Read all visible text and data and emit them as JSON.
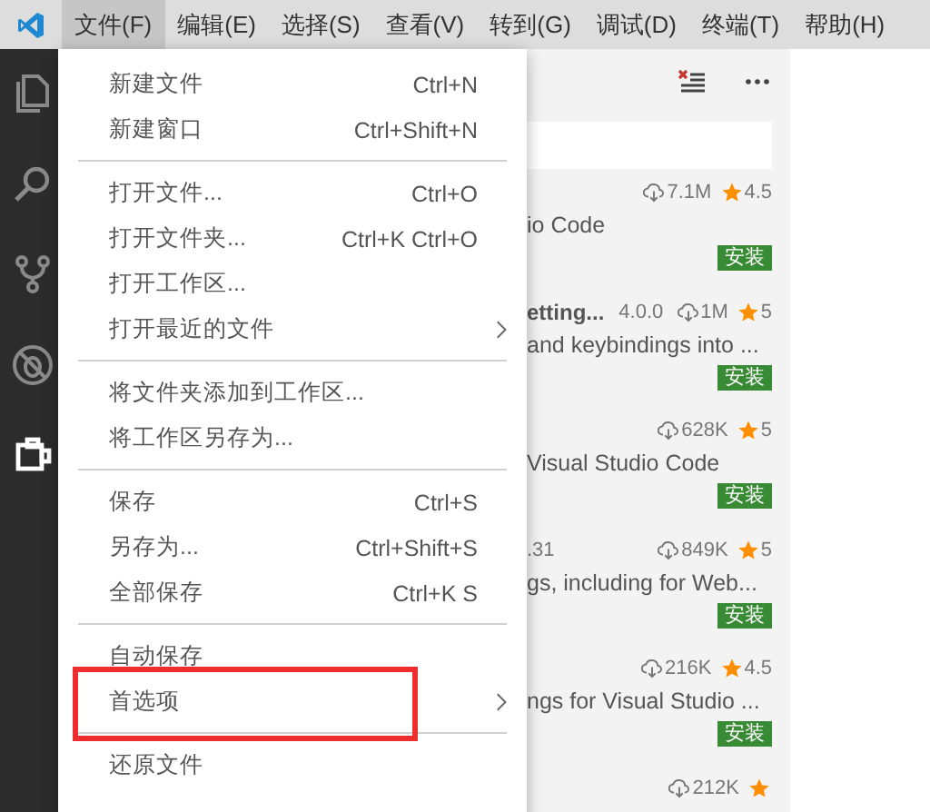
{
  "menubar": {
    "menus": [
      {
        "label": "文件(F)",
        "selected": true
      },
      {
        "label": "编辑(E)",
        "selected": false
      },
      {
        "label": "选择(S)",
        "selected": false
      },
      {
        "label": "查看(V)",
        "selected": false
      },
      {
        "label": "转到(G)",
        "selected": false
      },
      {
        "label": "调试(D)",
        "selected": false
      },
      {
        "label": "终端(T)",
        "selected": false
      },
      {
        "label": "帮助(H)",
        "selected": false
      }
    ]
  },
  "activity_bar": [
    {
      "kind": "files",
      "selected": false
    },
    {
      "kind": "search",
      "selected": false
    },
    {
      "kind": "source-control",
      "selected": false
    },
    {
      "kind": "debug",
      "selected": false
    },
    {
      "kind": "extensions",
      "selected": true
    }
  ],
  "file_menu": {
    "items": [
      {
        "kind": "item",
        "label": "新建文件",
        "shortcut": "Ctrl+N"
      },
      {
        "kind": "item",
        "label": "新建窗口",
        "shortcut": "Ctrl+Shift+N"
      },
      {
        "kind": "separator"
      },
      {
        "kind": "item",
        "label": "打开文件...",
        "shortcut": "Ctrl+O"
      },
      {
        "kind": "item",
        "label": "打开文件夹...",
        "shortcut": "Ctrl+K Ctrl+O"
      },
      {
        "kind": "item",
        "label": "打开工作区..."
      },
      {
        "kind": "submenu",
        "label": "打开最近的文件"
      },
      {
        "kind": "separator"
      },
      {
        "kind": "item",
        "label": "将文件夹添加到工作区..."
      },
      {
        "kind": "item",
        "label": "将工作区另存为..."
      },
      {
        "kind": "separator"
      },
      {
        "kind": "item",
        "label": "保存",
        "shortcut": "Ctrl+S"
      },
      {
        "kind": "item",
        "label": "另存为...",
        "shortcut": "Ctrl+Shift+S"
      },
      {
        "kind": "item",
        "label": "全部保存",
        "shortcut": "Ctrl+K S"
      },
      {
        "kind": "separator"
      },
      {
        "kind": "item",
        "label": "自动保存"
      },
      {
        "kind": "submenu",
        "label": "首选项"
      },
      {
        "kind": "separator"
      },
      {
        "kind": "item",
        "label": "还原文件"
      }
    ]
  },
  "extensions": [
    {
      "downloads": "7.1M",
      "rating": "4.5",
      "description": "io Code",
      "action": "安装"
    },
    {
      "name": "etting...",
      "version": "4.0.0",
      "downloads": "1M",
      "rating": "5",
      "description": "and keybindings into ...",
      "action": "安装"
    },
    {
      "downloads": "628K",
      "rating": "5",
      "description": "Visual Studio Code",
      "action": "安装"
    },
    {
      "version": ".31",
      "downloads": "849K",
      "rating": "5",
      "description": "gs, including for Web...",
      "action": "安装"
    },
    {
      "downloads": "216K",
      "rating": "4.5",
      "description": "ngs for Visual Studio ...",
      "action": "安装"
    },
    {
      "downloads": "212K"
    }
  ]
}
